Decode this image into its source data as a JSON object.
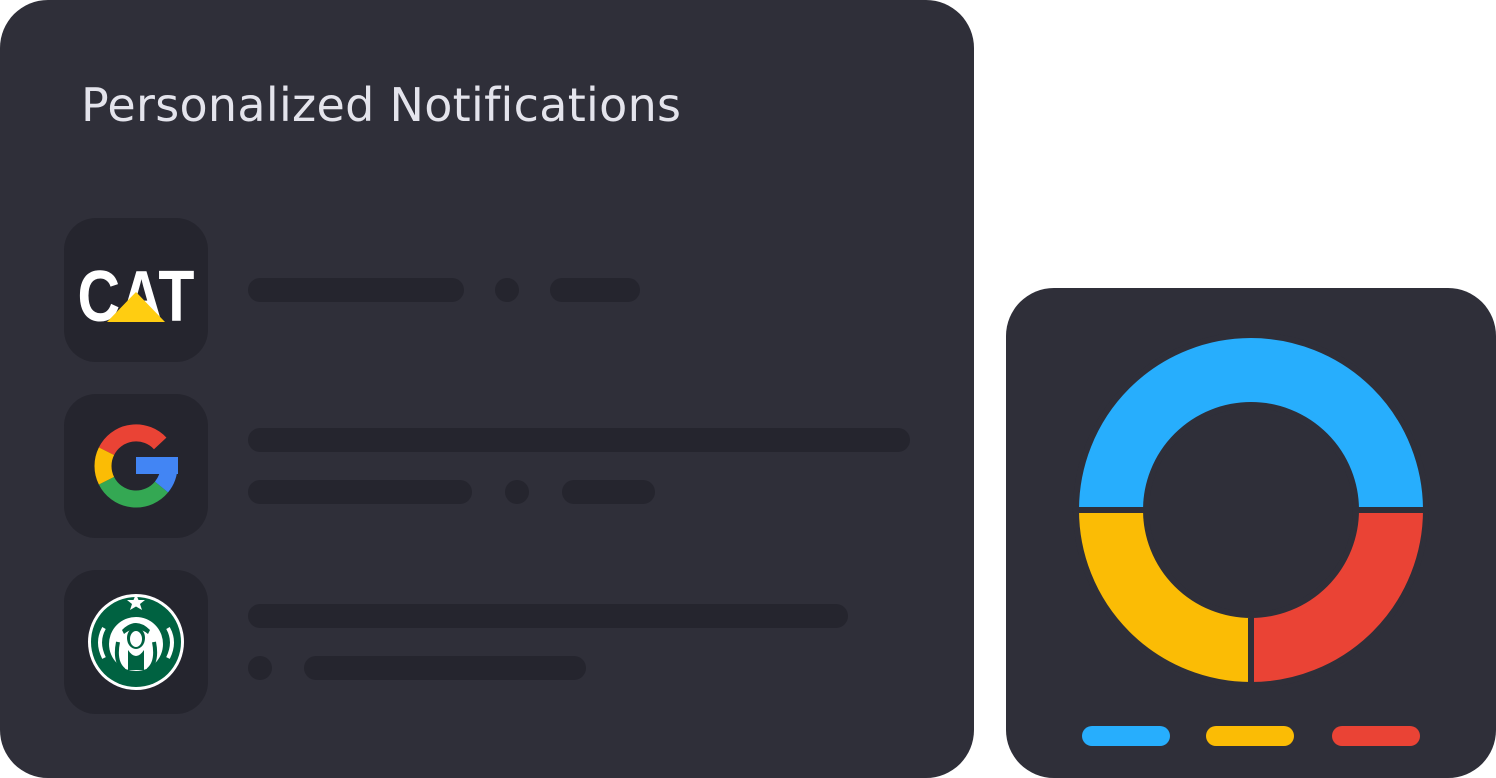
{
  "header": {
    "title": "Personalized Notifications"
  },
  "notifications": [
    {
      "brand": "CAT",
      "logo_icon": "cat-logo-icon"
    },
    {
      "brand": "Google",
      "logo_icon": "google-logo-icon"
    },
    {
      "brand": "Starbucks",
      "logo_icon": "starbucks-logo-icon"
    }
  ],
  "colors": {
    "panel": "#2f2f39",
    "skeleton": "#25252e",
    "blue": "#27aefd",
    "yellow": "#fbbc05",
    "red": "#ea4335",
    "google_green": "#34a853",
    "google_blue": "#4285f4",
    "starbucks_green": "#006241",
    "cat_yellow": "#ffcd11"
  },
  "chart_data": {
    "type": "pie",
    "categories": [
      "",
      "",
      ""
    ],
    "values": [
      50,
      25,
      25
    ],
    "colors": [
      "#27aefd",
      "#ea4335",
      "#fbbc05"
    ],
    "legend_position": "bottom"
  }
}
